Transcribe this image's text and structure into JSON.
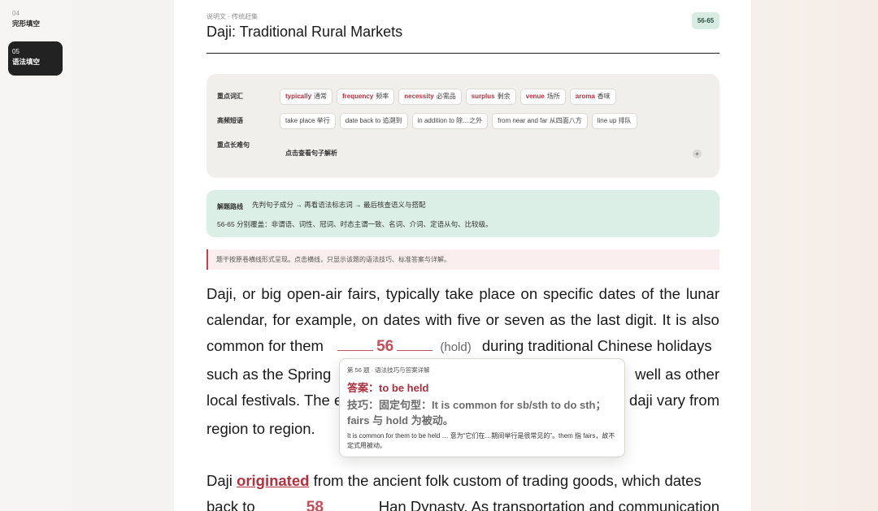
{
  "sidebar": {
    "items": [
      {
        "num": "04",
        "label": "完形填空"
      },
      {
        "num": "05",
        "label": "语法填空"
      }
    ]
  },
  "header": {
    "eyebrow": "说明文 · 传统赶集",
    "title": "Daji: Traditional Rural Markets",
    "badge": "56-65"
  },
  "vocab": {
    "label_words": "重点词汇",
    "label_phrases": "高频短语",
    "label_sentences": "重点长难句",
    "words": [
      {
        "en": "typically",
        "zh": "通常"
      },
      {
        "en": "frequency",
        "zh": "频率"
      },
      {
        "en": "necessity",
        "zh": "必需品"
      },
      {
        "en": "surplus",
        "zh": "剩余"
      },
      {
        "en": "venue",
        "zh": "场所"
      },
      {
        "en": "aroma",
        "zh": "香味"
      }
    ],
    "phrases": [
      "take place 举行",
      "date back to 追溯到",
      "in addition to 除…之外",
      "from near and far 从四面八方",
      "line up 排队"
    ],
    "sentence_toggle": "点击查看句子解析",
    "plus_icon": "+"
  },
  "tips": {
    "label": "解题路线",
    "text": "先判句子成分 → 再看语法标志词 → 最后核查语义与搭配",
    "line2": "56-65 分别覆盖：非谓语、词性、冠词、时态主谓一致、名词、介词、定语从句、比较级。"
  },
  "notice": "题干按原卷横线形式呈现。点击横线，只显示该题的语法技巧、标准答案与详解。",
  "passage": {
    "p1": {
      "line1": [
        "Daji,",
        "or",
        "big",
        "open-air",
        "fairs,",
        "typically",
        "take",
        "place",
        "on",
        "specific",
        "dates",
        "of",
        "the",
        "lunar"
      ],
      "line2": [
        "calendar,",
        "for",
        "example,",
        "on",
        "dates",
        "with",
        "five",
        "or",
        "seven",
        "as",
        "the",
        "last",
        "digit.",
        "It",
        "is",
        "also"
      ],
      "line3_start": "common for them",
      "blank56": "56",
      "hint56": "(hold)",
      "line3_end": "during traditional Chinese holidays",
      "line4_start": "such as the Spring",
      "line4_end": "well as other",
      "line5_start": "local festivals. The e",
      "line5_end": "daji vary from",
      "line6": "region to region."
    },
    "p2": {
      "line1_start": "Daji",
      "keyword": "originated",
      "line1_end": "from the ancient folk custom of trading goods, which dates",
      "line2_start": "back to",
      "blank58": "58",
      "line2_end": "Han Dynasty. As transportation and communication"
    }
  },
  "popup": {
    "eyebrow": "第 56 题 · 语法技巧与答案详解",
    "answer": "答案：to be held",
    "trick": "技巧：固定句型：It is common for sb/sth to do sth；fairs 与 hold 为被动。",
    "detail": "It is common for them to be held … 意为“它们在…期间举行是很常见的”。them 指 fairs，故不定式用被动。"
  },
  "colors": {
    "accent": "#b0323f",
    "badge_bg": "#d7ece2",
    "tips_bg": "#dcefe6",
    "notice_bg": "#fbeeee"
  }
}
